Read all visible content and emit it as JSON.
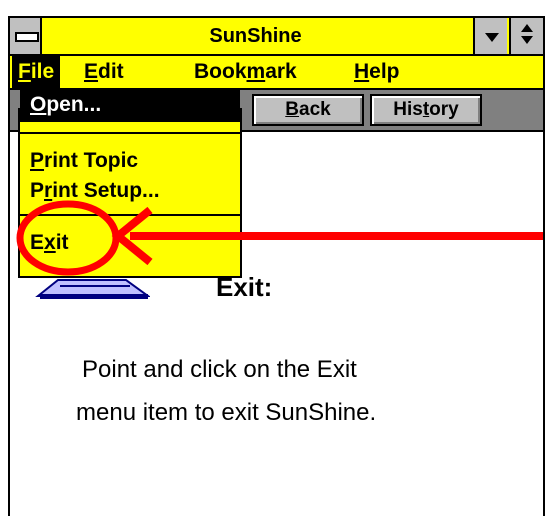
{
  "window": {
    "title": "SunShine"
  },
  "menubar": {
    "file": {
      "first": "F",
      "rest": "ile"
    },
    "edit": {
      "first": "E",
      "rest": "dit"
    },
    "bookmark": {
      "pre": "Book",
      "ul": "m",
      "post": "ark"
    },
    "help": {
      "first": "H",
      "rest": "elp"
    }
  },
  "toolbar": {
    "back": {
      "first": "B",
      "rest": "ack"
    },
    "history": {
      "pre": "His",
      "ul": "t",
      "post": "ory"
    }
  },
  "file_menu": {
    "open": {
      "first": "O",
      "rest": "pen..."
    },
    "print_topic": {
      "first": "P",
      "rest": "rint Topic"
    },
    "print_setup": {
      "pre": "P",
      "ul": "r",
      "post": "int Setup..."
    },
    "exit": {
      "pre": "E",
      "ul": "x",
      "post": "it"
    }
  },
  "content": {
    "heading": "Exit:",
    "line1": "Point and click on the Exit",
    "line2": "menu item to exit SunShine."
  },
  "colors": {
    "titlebar": "#ffff00",
    "annotation": "#ff0000",
    "menu_highlight": "#000000"
  },
  "icons": {
    "system_menu": "system-menu-icon",
    "minimize": "minimize-arrow-icon",
    "restore": "restore-arrows-icon",
    "annotation_arrow": "red-arrow-icon",
    "annotation_circle": "red-circle-icon"
  }
}
